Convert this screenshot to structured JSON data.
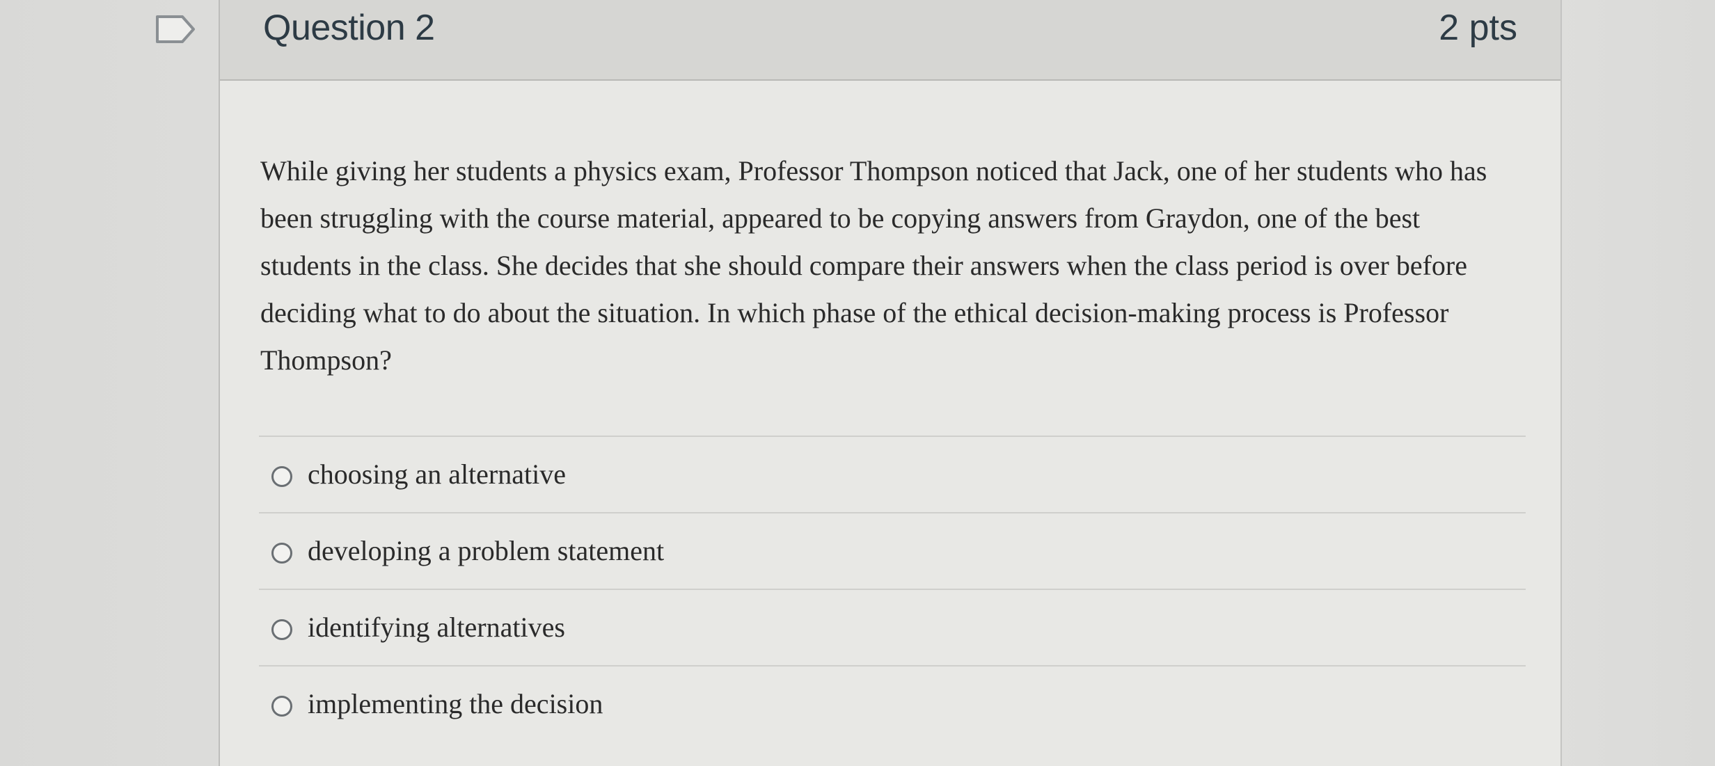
{
  "question": {
    "title": "Question 2",
    "points": "2 pts",
    "flag_icon": "flag-outline-icon",
    "text": "While giving her students a physics exam, Professor Thompson noticed that Jack, one of her students who has been struggling with the course material, appeared to be copying answers from Graydon, one of the best students in the class. She decides that she should compare their answers when the class period is over before deciding what to do about the situation. In which phase of the ethical decision-making process is Professor Thompson?",
    "answers": [
      {
        "label": "choosing an alternative",
        "selected": false
      },
      {
        "label": "developing a problem statement",
        "selected": false
      },
      {
        "label": "identifying alternatives",
        "selected": false
      },
      {
        "label": "implementing the decision",
        "selected": false
      }
    ]
  },
  "colors": {
    "header_bg": "#d6d6d3",
    "card_bg": "#e8e8e5",
    "title_text": "#2d3b45",
    "body_text": "#2a2a2a"
  }
}
